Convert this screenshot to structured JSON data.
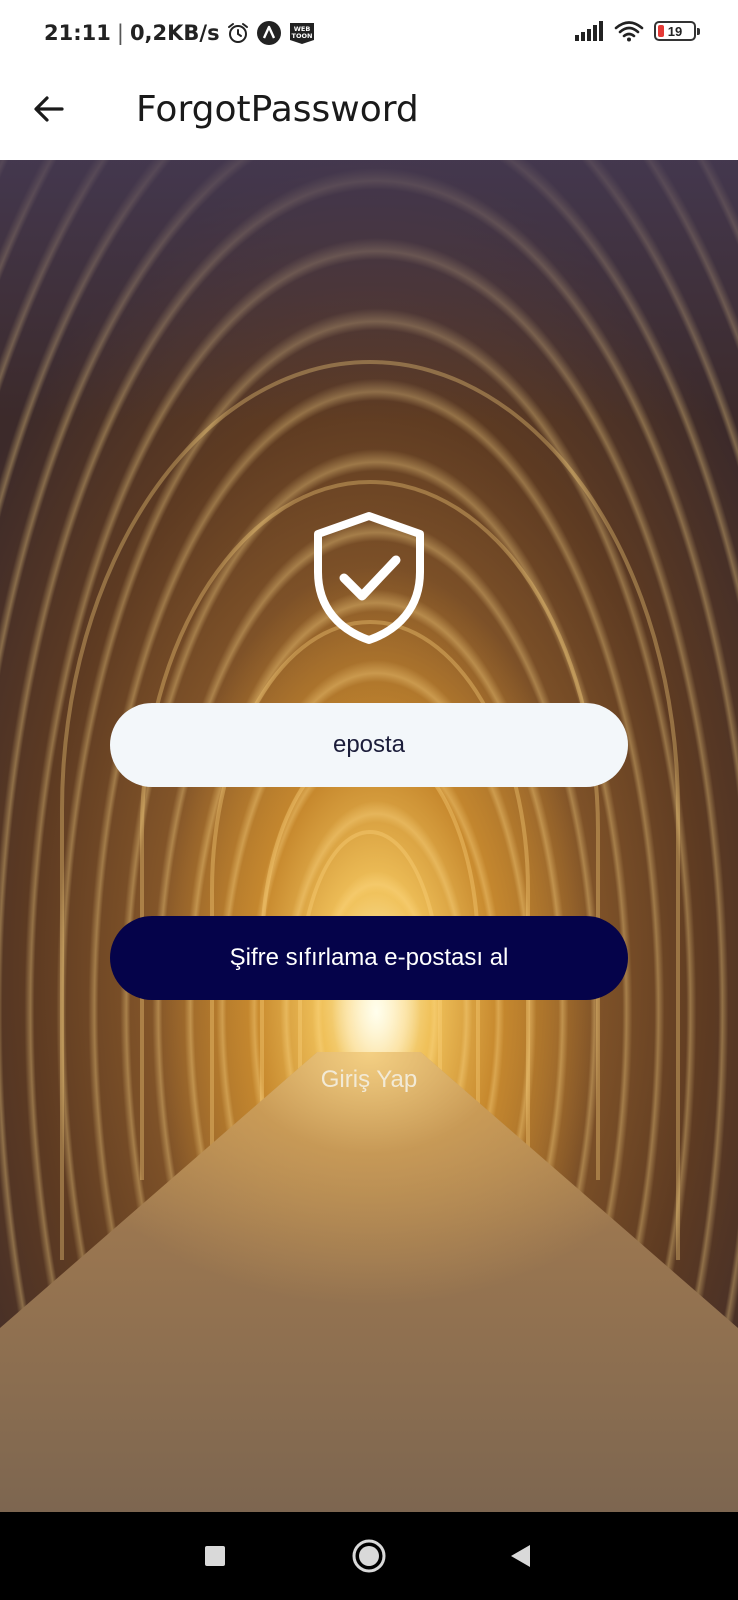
{
  "status_bar": {
    "time": "21:11",
    "separator": "|",
    "network_speed": "0,2KB/s",
    "battery_level": "19",
    "icons": [
      "alarm-icon",
      "app-a-icon",
      "webtoon-icon",
      "signal-icon",
      "wifi-icon",
      "battery-icon"
    ],
    "webtoon_label": "WEB TOON"
  },
  "app_bar": {
    "title": "ForgotPassword",
    "back_icon": "arrow-left-icon"
  },
  "main": {
    "logo_icon": "shield-check-icon",
    "email_placeholder": "eposta",
    "reset_button_label": "Şifre sıfırlama e-postası al",
    "login_link_label": "Giriş Yap"
  },
  "nav_bar": {
    "buttons": [
      "square-recents-icon",
      "circle-home-icon",
      "triangle-back-icon"
    ]
  },
  "colors": {
    "button_bg": "#05034a",
    "input_bg": "#f3f7fa",
    "battery_low": "#e53935"
  }
}
